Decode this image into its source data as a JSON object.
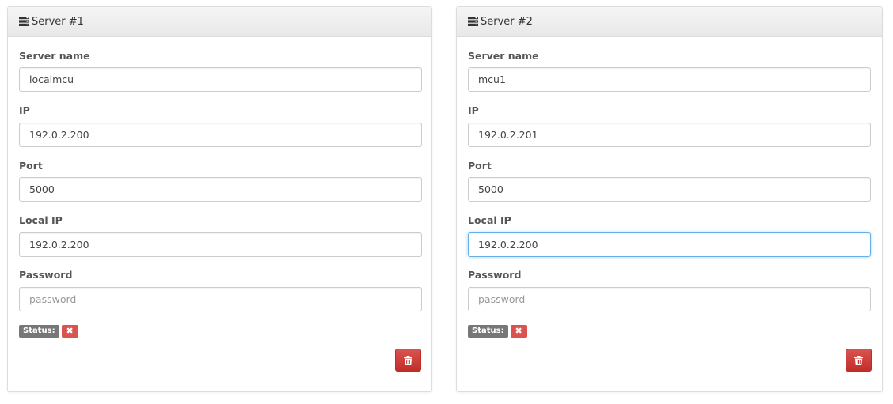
{
  "servers": [
    {
      "title": "Server #1",
      "fields": {
        "server_name": {
          "label": "Server name",
          "value": "localmcu"
        },
        "ip": {
          "label": "IP",
          "value": "192.0.2.200"
        },
        "port": {
          "label": "Port",
          "value": "5000"
        },
        "local_ip": {
          "label": "Local IP",
          "value": "192.0.2.200"
        },
        "password": {
          "label": "Password",
          "value": "",
          "placeholder": "password"
        }
      },
      "status": {
        "label": "Status:",
        "value_icon": "✖"
      },
      "delete_icon": "trash-icon"
    },
    {
      "title": "Server #2",
      "fields": {
        "server_name": {
          "label": "Server name",
          "value": "mcu1"
        },
        "ip": {
          "label": "IP",
          "value": "192.0.2.201"
        },
        "port": {
          "label": "Port",
          "value": "5000"
        },
        "local_ip": {
          "label": "Local IP",
          "value": "192.0.2.200"
        },
        "password": {
          "label": "Password",
          "value": "",
          "placeholder": "password"
        }
      },
      "status": {
        "label": "Status:",
        "value_icon": "✖"
      },
      "delete_icon": "trash-icon"
    }
  ],
  "colors": {
    "danger": "#d9534f",
    "status_label_bg": "#777777",
    "focus_border": "#66afe9",
    "heading_bg": "#f5f5f5"
  }
}
